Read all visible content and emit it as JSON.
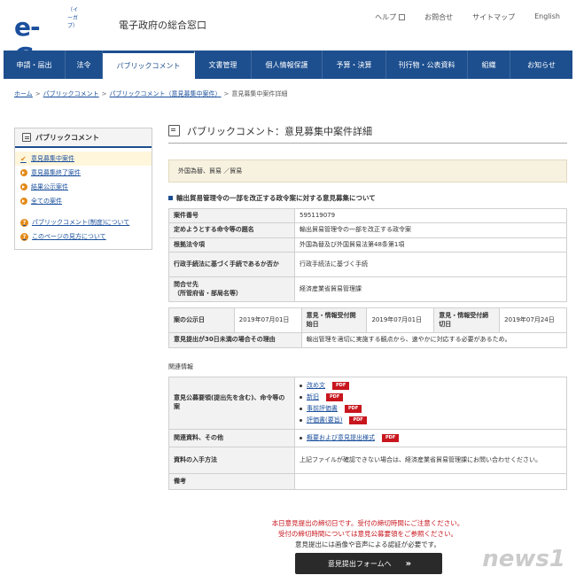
{
  "header": {
    "logo": "e-Gov",
    "logo_sub": "（イーガブ）",
    "logo_text": "電子政府の総合窓口",
    "util_links": [
      "ヘルプ",
      "お問合せ",
      "サイトマップ",
      "English"
    ]
  },
  "nav": {
    "items": [
      "申請・届出",
      "法令",
      "パブリックコメント",
      "文書管理",
      "個人情報保護",
      "予算・決算",
      "刊行物・公表資料",
      "組織",
      "お知らせ"
    ],
    "active_index": 2
  },
  "breadcrumb": {
    "items": [
      "ホーム",
      "パブリックコメント",
      "パブリックコメント（意見募集中案件）",
      "意見募集中案件詳細"
    ],
    "separator": ">"
  },
  "sidebar": {
    "title": "パブリックコメント",
    "items": [
      {
        "label": "意見募集中案件",
        "active": true
      },
      {
        "label": "意見募集終了案件"
      },
      {
        "label": "結果公示案件"
      },
      {
        "label": "全ての案件"
      }
    ],
    "help_items": [
      {
        "label": "パブリックコメント(制度)について"
      },
      {
        "label": "このページの見方について"
      }
    ]
  },
  "content": {
    "page_title": "パブリックコメント：意見募集中案件詳細",
    "category": "外国為替、貿易 ／貿易",
    "case_title": "輸出貿易管理令の一部を改正する政令案に対する意見募集について",
    "info_rows": [
      {
        "label": "案件番号",
        "value": "595119079"
      },
      {
        "label": "定めようとする命令等の題名",
        "value": "輸出貿易管理令の一部を改正する政令案"
      },
      {
        "label": "根拠法令項",
        "value": "外国為替及び外国貿易法第48条第1項"
      },
      {
        "label": "行政手続法に基づく手続であるか否か",
        "value": "行政手続法に基づく手続"
      },
      {
        "label": "問合せ先\n（所管府省・部局名等）",
        "value": "経済産業省貿易管理課"
      }
    ],
    "date_row": {
      "announce_label": "案の公示日",
      "announce_value": "2019年07月01日",
      "start_label": "意見・情報受付開始日",
      "start_value": "2019年07月01日",
      "end_label": "意見・情報受付締切日",
      "end_value": "2019年07月24日"
    },
    "reason_row": {
      "label": "意見提出が30日未満の場合その理由",
      "value": "輸出管理を適切に実施する観点から、速やかに対応する必要があるため。"
    },
    "related_label": "関連情報",
    "related_rows": {
      "doc_label": "意見公募要領(提出先を含む)、命令等の案",
      "docs": [
        "改め文",
        "新旧",
        "事前評価書",
        "評価書(要旨)"
      ],
      "other_label": "関連資料、その他",
      "other_docs": [
        "概要および意見提出様式"
      ],
      "pdf_tag": "PDF",
      "obtain_label": "資料の入手方法",
      "obtain_value": "上記ファイルが確認できない場合は、経済産業省貿易管理課にお問い合わせください。",
      "remarks_label": "備考",
      "remarks_value": ""
    }
  },
  "notice": {
    "line1": "本日意見提出の締切日です。受付の締切時間にご注意ください。",
    "line2": "受付の締切時間については意見公募要領をご参照ください。",
    "line3": "意見提出には画像や音声による認証が必要です。"
  },
  "submit_button": {
    "label": "意見提出フォームへ",
    "chevron": "»"
  },
  "watermark": "news1"
}
